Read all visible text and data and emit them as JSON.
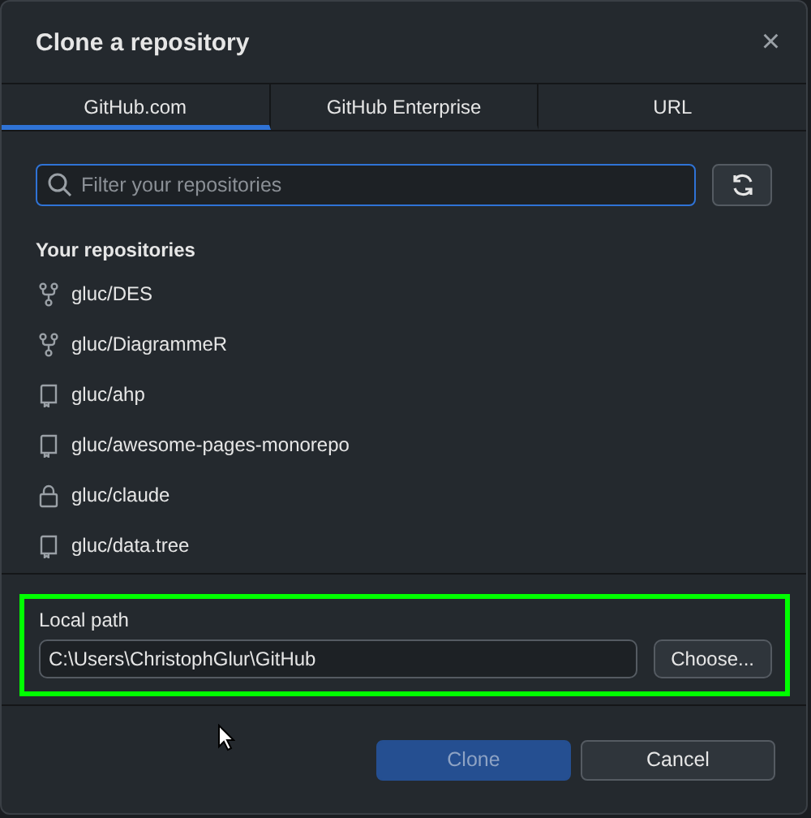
{
  "window": {
    "title": "Clone a repository",
    "close": "×"
  },
  "tabs": [
    {
      "label": "GitHub.com",
      "selected": true
    },
    {
      "label": "GitHub Enterprise",
      "selected": false
    },
    {
      "label": "URL",
      "selected": false
    }
  ],
  "search": {
    "placeholder": "Filter your repositories"
  },
  "repositories": {
    "heading": "Your repositories",
    "items": [
      {
        "name": "gluc/DES",
        "kind": "fork"
      },
      {
        "name": "gluc/DiagrammeR",
        "kind": "fork"
      },
      {
        "name": "gluc/ahp",
        "kind": "repo"
      },
      {
        "name": "gluc/awesome-pages-monorepo",
        "kind": "repo"
      },
      {
        "name": "gluc/claude",
        "kind": "private"
      },
      {
        "name": "gluc/data.tree",
        "kind": "repo"
      }
    ]
  },
  "local_path": {
    "label": "Local path",
    "value": "C:\\Users\\ChristophGlur\\GitHub",
    "button": "Choose...",
    "highlighted": true
  },
  "buttons": [
    {
      "label": "Clone",
      "kind": "primary",
      "disabled": true
    },
    {
      "label": "Cancel",
      "kind": "secondary",
      "disabled": false
    }
  ]
}
